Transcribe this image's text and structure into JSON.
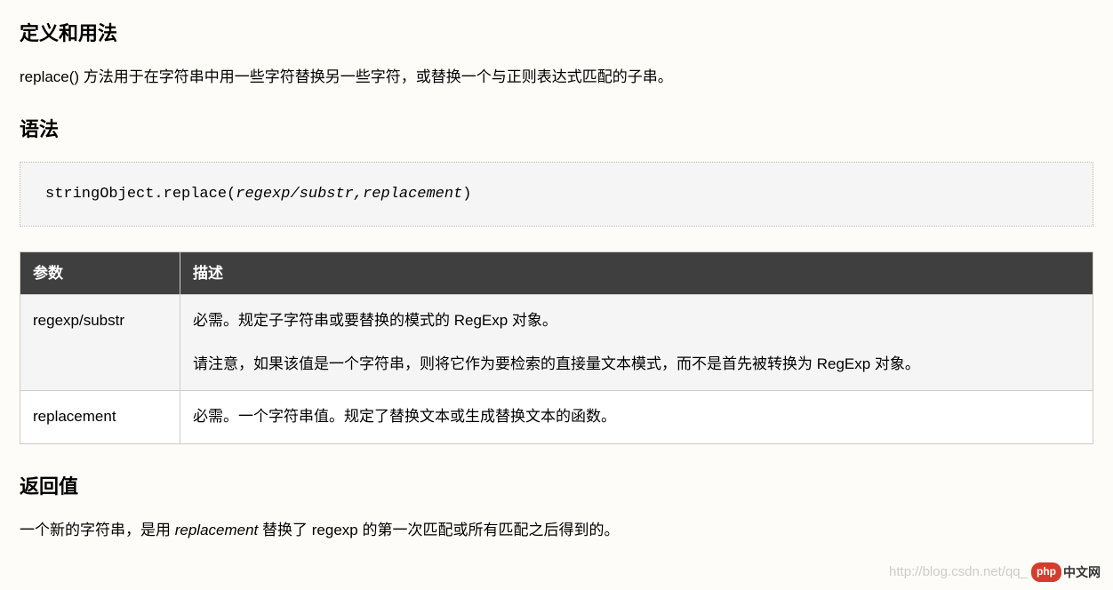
{
  "section1": {
    "heading": "定义和用法",
    "description": "replace() 方法用于在字符串中用一些字符替换另一些字符，或替换一个与正则表达式匹配的子串。"
  },
  "section2": {
    "heading": "语法",
    "code_prefix": "stringObject.replace(",
    "code_args": "regexp/substr,replacement",
    "code_suffix": ")"
  },
  "table": {
    "headers": [
      "参数",
      "描述"
    ],
    "rows": [
      {
        "param": "regexp/substr",
        "desc_parts": [
          "必需。规定子字符串或要替换的模式的 RegExp 对象。",
          "请注意，如果该值是一个字符串，则将它作为要检索的直接量文本模式，而不是首先被转换为 RegExp 对象。"
        ]
      },
      {
        "param": "replacement",
        "desc_parts": [
          "必需。一个字符串值。规定了替换文本或生成替换文本的函数。"
        ]
      }
    ]
  },
  "section3": {
    "heading": "返回值",
    "desc_prefix": "一个新的字符串，是用 ",
    "desc_italic": "replacement",
    "desc_suffix": " 替换了 regexp 的第一次匹配或所有匹配之后得到的。"
  },
  "watermark": {
    "url": "http://blog.csdn.net/qq_",
    "badge": "php",
    "cn": "中文网"
  }
}
